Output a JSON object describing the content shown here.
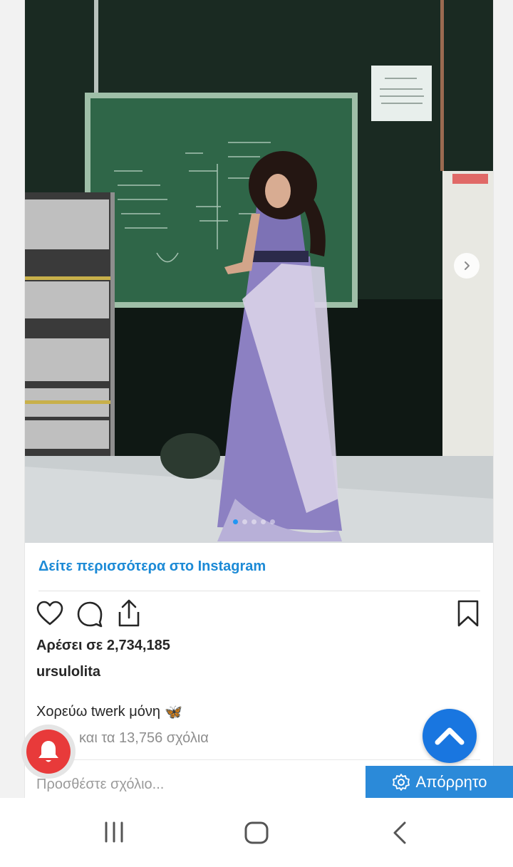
{
  "post": {
    "image_alt": "ursulolita post photo",
    "see_more_label": "Δείτε περισσότερα στο Instagram",
    "likes_text": "Αρέσει σε 2,734,185",
    "username": "ursulolita",
    "caption": "Χορεύω twerk μόνη",
    "caption_emoji": "🦋",
    "comments_text": "και τα 13,756 σχόλια",
    "add_comment_placeholder": "Προσθέστε σχόλιο...",
    "carousel": {
      "total": 5,
      "current": 1
    }
  },
  "overlays": {
    "privacy_label": "Απόρρητο"
  },
  "icons": {
    "like": "heart-icon",
    "comment": "comment-icon",
    "share": "share-icon",
    "save": "bookmark-icon",
    "next": "chevron-right-icon",
    "bell": "bell-icon",
    "scroll_top": "chevron-up-icon",
    "privacy": "gear-icon",
    "nav_recents": "recents-icon",
    "nav_home": "home-icon",
    "nav_back": "back-icon"
  },
  "colors": {
    "link": "#1c8ad6",
    "active_dot": "#2196f3",
    "scroll_top_bg": "#1976e0",
    "bell_bg": "#e83a3a",
    "privacy_bg": "#2b8ad9"
  }
}
